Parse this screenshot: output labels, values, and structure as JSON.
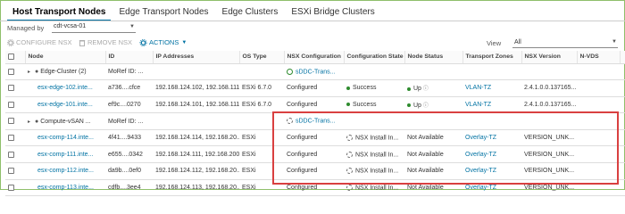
{
  "tabs": [
    {
      "label": "Host Transport Nodes"
    },
    {
      "label": "Edge Transport Nodes"
    },
    {
      "label": "Edge Clusters"
    },
    {
      "label": "ESXi Bridge Clusters"
    }
  ],
  "managed_by": {
    "label": "Managed by",
    "value": "cdt-vcsa-01"
  },
  "toolbar": {
    "configure": "CONFIGURE NSX",
    "remove": "REMOVE NSX",
    "actions": "ACTIONS"
  },
  "view": {
    "label": "View",
    "value": "All"
  },
  "columns": [
    "Node",
    "ID",
    "IP Addresses",
    "OS Type",
    "NSX Configuration",
    "Configuration State",
    "Node Status",
    "Transport Zones",
    "NSX Version",
    "N-VDS",
    ""
  ],
  "rows": [
    {
      "node": "Edge-Cluster (2)",
      "id": "MoRef ID: ...",
      "ip": "",
      "os": "",
      "config": "sDDC-Trans...",
      "state": "",
      "status": "",
      "tz": "",
      "ver": "",
      "nvds": "",
      "num": ""
    },
    {
      "node": "esx-edge-102.inte...",
      "id": "a736....cfce",
      "ip": "192.168.124.102, 192.168.111...",
      "os": "ESXi 6.7.0",
      "config": "Configured",
      "state": "Success",
      "status": "Up",
      "tz": "VLAN-TZ",
      "ver": "2.4.1.0.0.137165...",
      "nvds": "",
      "num": "1"
    },
    {
      "node": "esx-edge-101.inte...",
      "id": "ef9c....0270",
      "ip": "192.168.124.101, 192.168.111...",
      "os": "ESXi 6.7.0",
      "config": "Configured",
      "state": "Success",
      "status": "Up",
      "tz": "VLAN-TZ",
      "ver": "2.4.1.0.0.137165...",
      "nvds": "",
      "num": "1"
    },
    {
      "node": "Compute-vSAN ...",
      "id": "MoRef ID: ...",
      "ip": "",
      "os": "",
      "config": "sDDC-Trans...",
      "state": "",
      "status": "",
      "tz": "",
      "ver": "",
      "nvds": "",
      "num": ""
    },
    {
      "node": "esx-comp-114.inte...",
      "id": "4f41....9433",
      "ip": "192.168.124.114, 192.168.20...",
      "os": "ESXi",
      "config": "Configured",
      "state": "NSX Install In...",
      "status": "Not Available",
      "tz": "Overlay-TZ",
      "ver": "VERSION_UNK...",
      "nvds": "",
      "num": "1"
    },
    {
      "node": "esx-comp-111.inte...",
      "id": "e655....0342",
      "ip": "192.168.124.111, 192.168.200...",
      "os": "ESXi",
      "config": "Configured",
      "state": "NSX Install In...",
      "status": "Not Available",
      "tz": "Overlay-TZ",
      "ver": "VERSION_UNK...",
      "nvds": "",
      "num": "1"
    },
    {
      "node": "esx-comp-112.inte...",
      "id": "da9b....0ef0",
      "ip": "192.168.124.112, 192.168.20...",
      "os": "ESXi",
      "config": "Configured",
      "state": "NSX Install In...",
      "status": "Not Available",
      "tz": "Overlay-TZ",
      "ver": "VERSION_UNK...",
      "nvds": "",
      "num": "1"
    },
    {
      "node": "esx-comp-113.inte...",
      "id": "cdfb....3ee4",
      "ip": "192.168.124.113, 192.168.20...",
      "os": "ESXi",
      "config": "Configured",
      "state": "NSX Install In...",
      "status": "Not Available",
      "tz": "Overlay-TZ",
      "ver": "VERSION_UNK...",
      "nvds": "",
      "num": "1"
    }
  ]
}
